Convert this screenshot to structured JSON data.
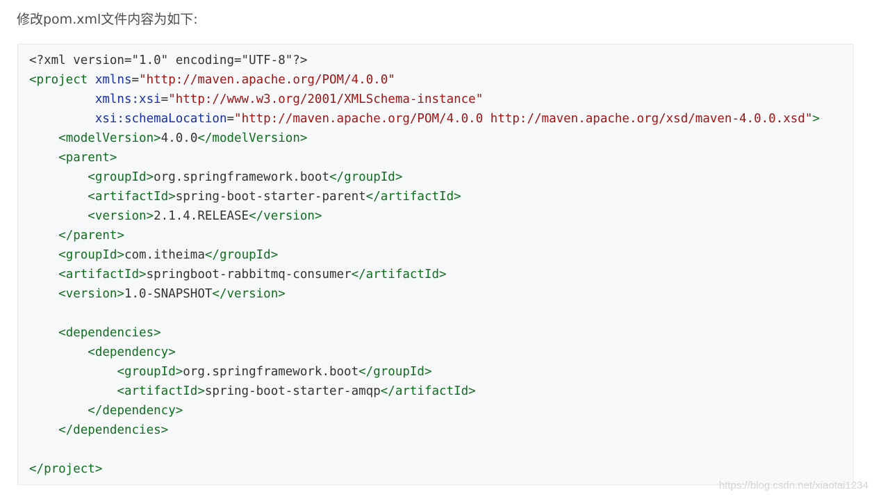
{
  "intro_text": "修改pom.xml文件内容为如下:",
  "code_lines": [
    [
      {
        "t": "plain",
        "v": "<?xml version=\"1.0\" encoding=\"UTF-8\"?>"
      }
    ],
    [
      {
        "t": "tag",
        "v": "<project"
      },
      {
        "t": "plain",
        "v": " "
      },
      {
        "t": "attr",
        "v": "xmlns"
      },
      {
        "t": "plain",
        "v": "="
      },
      {
        "t": "str",
        "v": "\"http://maven.apache.org/POM/4.0.0\""
      }
    ],
    [
      {
        "t": "plain",
        "v": "         "
      },
      {
        "t": "attr",
        "v": "xmlns:xsi"
      },
      {
        "t": "plain",
        "v": "="
      },
      {
        "t": "str",
        "v": "\"http://www.w3.org/2001/XMLSchema-instance\""
      }
    ],
    [
      {
        "t": "plain",
        "v": "         "
      },
      {
        "t": "attr",
        "v": "xsi:schemaLocation"
      },
      {
        "t": "plain",
        "v": "="
      },
      {
        "t": "str",
        "v": "\"http://maven.apache.org/POM/4.0.0 http://maven.apache.org/xsd/maven-4.0.0.xsd\""
      },
      {
        "t": "tag",
        "v": ">"
      }
    ],
    [
      {
        "t": "plain",
        "v": "    "
      },
      {
        "t": "tag",
        "v": "<modelVersion>"
      },
      {
        "t": "plain",
        "v": "4.0.0"
      },
      {
        "t": "tag",
        "v": "</modelVersion>"
      }
    ],
    [
      {
        "t": "plain",
        "v": "    "
      },
      {
        "t": "tag",
        "v": "<parent>"
      }
    ],
    [
      {
        "t": "plain",
        "v": "        "
      },
      {
        "t": "tag",
        "v": "<groupId>"
      },
      {
        "t": "plain",
        "v": "org.springframework.boot"
      },
      {
        "t": "tag",
        "v": "</groupId>"
      }
    ],
    [
      {
        "t": "plain",
        "v": "        "
      },
      {
        "t": "tag",
        "v": "<artifactId>"
      },
      {
        "t": "plain",
        "v": "spring-boot-starter-parent"
      },
      {
        "t": "tag",
        "v": "</artifactId>"
      }
    ],
    [
      {
        "t": "plain",
        "v": "        "
      },
      {
        "t": "tag",
        "v": "<version>"
      },
      {
        "t": "plain",
        "v": "2.1.4.RELEASE"
      },
      {
        "t": "tag",
        "v": "</version>"
      }
    ],
    [
      {
        "t": "plain",
        "v": "    "
      },
      {
        "t": "tag",
        "v": "</parent>"
      }
    ],
    [
      {
        "t": "plain",
        "v": "    "
      },
      {
        "t": "tag",
        "v": "<groupId>"
      },
      {
        "t": "plain",
        "v": "com.itheima"
      },
      {
        "t": "tag",
        "v": "</groupId>"
      }
    ],
    [
      {
        "t": "plain",
        "v": "    "
      },
      {
        "t": "tag",
        "v": "<artifactId>"
      },
      {
        "t": "plain",
        "v": "springboot-rabbitmq-consumer"
      },
      {
        "t": "tag",
        "v": "</artifactId>"
      }
    ],
    [
      {
        "t": "plain",
        "v": "    "
      },
      {
        "t": "tag",
        "v": "<version>"
      },
      {
        "t": "plain",
        "v": "1.0-SNAPSHOT"
      },
      {
        "t": "tag",
        "v": "</version>"
      }
    ],
    [],
    [
      {
        "t": "plain",
        "v": "    "
      },
      {
        "t": "tag",
        "v": "<dependencies>"
      }
    ],
    [
      {
        "t": "plain",
        "v": "        "
      },
      {
        "t": "tag",
        "v": "<dependency>"
      }
    ],
    [
      {
        "t": "plain",
        "v": "            "
      },
      {
        "t": "tag",
        "v": "<groupId>"
      },
      {
        "t": "plain",
        "v": "org.springframework.boot"
      },
      {
        "t": "tag",
        "v": "</groupId>"
      }
    ],
    [
      {
        "t": "plain",
        "v": "            "
      },
      {
        "t": "tag",
        "v": "<artifactId>"
      },
      {
        "t": "plain",
        "v": "spring-boot-starter-amqp"
      },
      {
        "t": "tag",
        "v": "</artifactId>"
      }
    ],
    [
      {
        "t": "plain",
        "v": "        "
      },
      {
        "t": "tag",
        "v": "</dependency>"
      }
    ],
    [
      {
        "t": "plain",
        "v": "    "
      },
      {
        "t": "tag",
        "v": "</dependencies>"
      }
    ],
    [],
    [
      {
        "t": "tag",
        "v": "</project>"
      }
    ]
  ],
  "watermark_text": "https://blog.csdn.net/xiaotai1234",
  "colors": {
    "tag": "#116e1f",
    "attribute": "#1a2ea3",
    "string": "#a31515",
    "plain": "#333333",
    "code_background": "#f6f8fa"
  }
}
